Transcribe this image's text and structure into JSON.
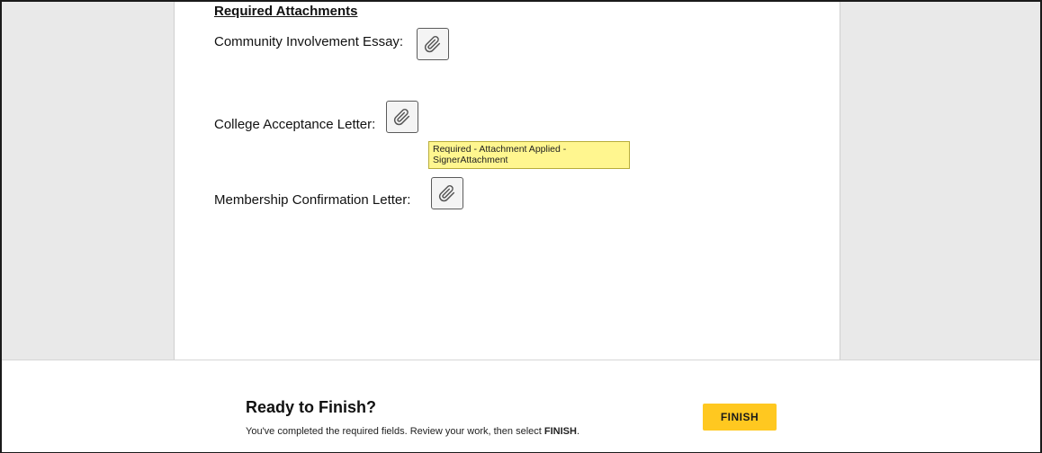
{
  "document": {
    "heading": "Required Attachments",
    "fields": [
      {
        "label": "Community Involvement Essay:",
        "icon": "paperclip-icon"
      },
      {
        "label": "College Acceptance Letter:",
        "icon": "paperclip-icon"
      },
      {
        "label": "Membership Confirmation Letter:",
        "icon": "paperclip-icon"
      }
    ],
    "tooltip": "Required - Attachment Applied - SignerAttachment"
  },
  "footer": {
    "title": "Ready to Finish?",
    "message_prefix": "You've completed the required fields. Review your work, then select ",
    "message_emphasis": "FINISH",
    "message_suffix": ".",
    "finish_label": "FINISH"
  },
  "colors": {
    "finish_button": "#ffc820",
    "tooltip_bg": "#fff68f",
    "background": "#e9e9e9"
  }
}
